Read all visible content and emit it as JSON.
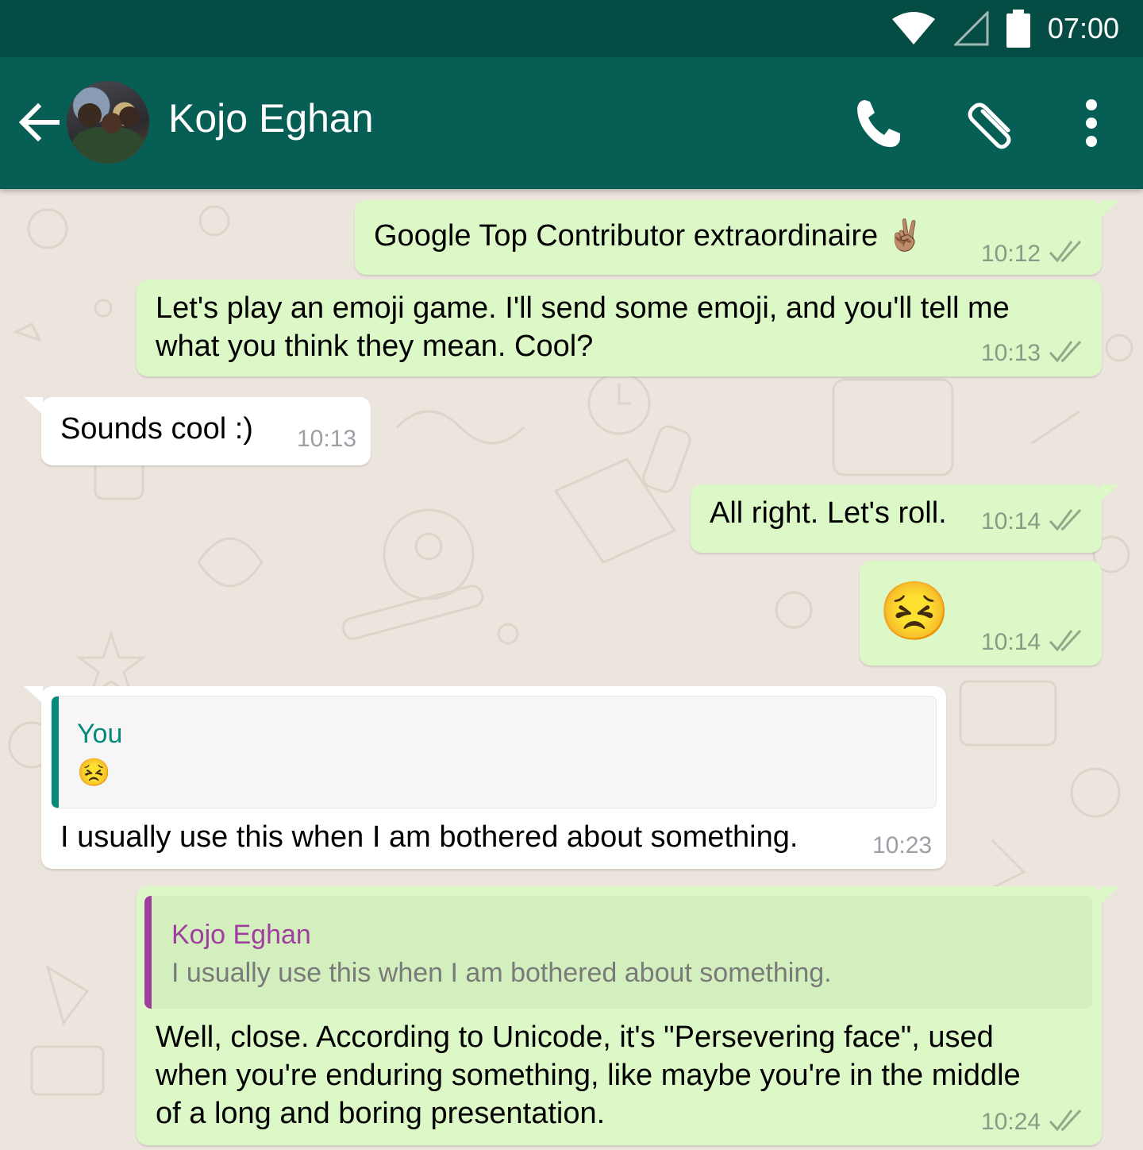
{
  "status_bar": {
    "time": "07:00",
    "icons": [
      "wifi-icon",
      "signal-icon",
      "battery-icon"
    ]
  },
  "header": {
    "contact_name": "Kojo Eghan",
    "actions": [
      "call",
      "attach",
      "more-options"
    ]
  },
  "colors": {
    "header": "#075e54",
    "status": "#054d44",
    "outgoing": "#dcf8c6",
    "incoming": "#ffffff",
    "read_ticks": "#8fa98a"
  },
  "messages": [
    {
      "direction": "out",
      "text": "Google Top Contributor extraordinaire ✌🏽",
      "time": "10:12"
    },
    {
      "direction": "out",
      "line1": "Let's play an emoji game. I'll send some emoji, and you'll tell me",
      "line2": "what you think they mean. Cool?",
      "time": "10:13"
    },
    {
      "direction": "in",
      "text": "Sounds cool :)",
      "time": "10:13"
    },
    {
      "direction": "out",
      "text": "All right. Let's roll.",
      "time": "10:14"
    },
    {
      "direction": "out",
      "emoji": "😣",
      "time": "10:14"
    },
    {
      "direction": "in",
      "quote_author": "You",
      "quote_text": "😣",
      "text": "I usually use this when I am bothered about something.",
      "time": "10:23"
    },
    {
      "direction": "out",
      "quote_author": "Kojo Eghan",
      "quote_text": "I usually use this when I am bothered about something.",
      "line1": "Well, close. According to Unicode, it's \"Persevering face\", used",
      "line2": "when you're enduring something, like maybe you're in the middle",
      "line3": "of a long and boring presentation.",
      "time": "10:24"
    }
  ]
}
